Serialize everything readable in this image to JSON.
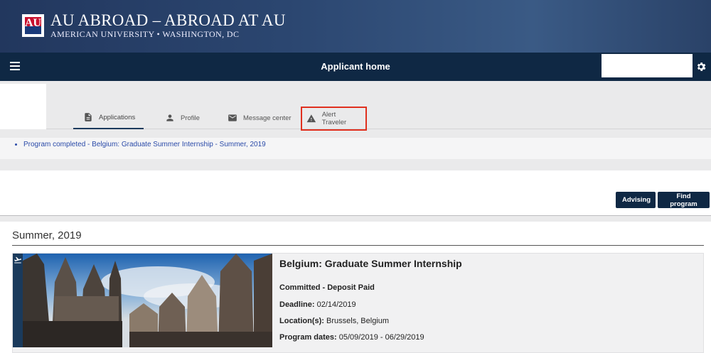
{
  "banner": {
    "logo_letters": "AU",
    "title": "AU ABROAD – ABROAD AT AU",
    "subtitle": "AMERICAN UNIVERSITY • WASHINGTON, DC"
  },
  "navbar": {
    "title": "Applicant home",
    "search_value": ""
  },
  "tabs": [
    {
      "label": "Applications",
      "icon": "document-icon",
      "active": true
    },
    {
      "label": "Profile",
      "icon": "person-icon",
      "active": false
    },
    {
      "label": "Message center",
      "icon": "envelope-icon",
      "active": false
    },
    {
      "label": "Alert Traveler",
      "icon": "warning-icon",
      "active": false
    }
  ],
  "completed_programs": [
    "Program completed - Belgium: Graduate Summer Internship - Summer, 2019"
  ],
  "actions": {
    "advising_label": "Advising",
    "find_program_label": "Find program"
  },
  "term": {
    "title": "Summer, 2019",
    "program": {
      "name": "Belgium: Graduate Summer Internship",
      "status": "Committed - Deposit Paid",
      "deadline_label": "Deadline:",
      "deadline": "02/14/2019",
      "location_label": "Location(s):",
      "location": "Brussels, Belgium",
      "dates_label": "Program dates:",
      "dates": "05/09/2019 - 06/29/2019"
    }
  },
  "colors": {
    "navbar": "#0f2844",
    "alert_highlight": "#e0301e",
    "link": "#2a4aa8"
  }
}
